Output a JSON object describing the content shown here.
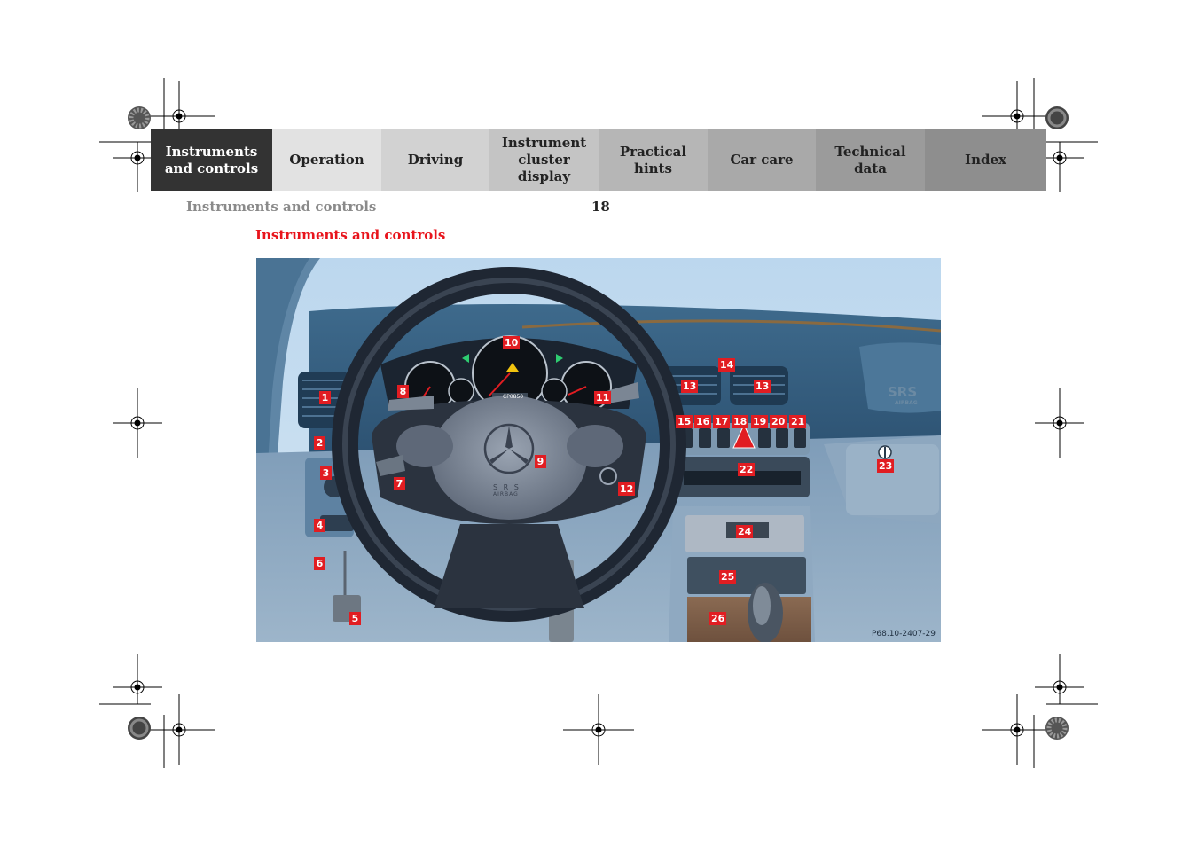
{
  "nav": {
    "tabs": [
      {
        "label": "Instruments\nand controls",
        "active": true,
        "color": "#333333"
      },
      {
        "label": "Operation",
        "active": false,
        "color": "#e2e2e2"
      },
      {
        "label": "Driving",
        "active": false,
        "color": "#d2d2d2"
      },
      {
        "label": "Instrument\ncluster display",
        "active": false,
        "color": "#c4c4c4"
      },
      {
        "label": "Practical hints",
        "active": false,
        "color": "#b6b6b6"
      },
      {
        "label": "Car care",
        "active": false,
        "color": "#a9a9a9"
      },
      {
        "label": "Technical\ndata",
        "active": false,
        "color": "#9b9b9b"
      },
      {
        "label": "Index",
        "active": false,
        "color": "#8e8e8e"
      }
    ]
  },
  "header": {
    "section_title": "Instruments and controls",
    "page_number": "18"
  },
  "content": {
    "heading": "Instruments and controls",
    "heading_color": "#e8141c"
  },
  "figure": {
    "callouts": [
      "1",
      "2",
      "3",
      "4",
      "5",
      "6",
      "7",
      "8",
      "9",
      "10",
      "11",
      "12",
      "13",
      "13",
      "14",
      "15",
      "16",
      "17",
      "18",
      "19",
      "20",
      "21",
      "22",
      "23",
      "24",
      "25",
      "26"
    ],
    "code": "P68.10-2407-29",
    "cluster_readout": "CP0850",
    "airbag_text": "S R S",
    "airbag_subtext": "AIRBAG",
    "dash_badge": "SRS",
    "dash_badge_sub": "AIRBAG"
  }
}
